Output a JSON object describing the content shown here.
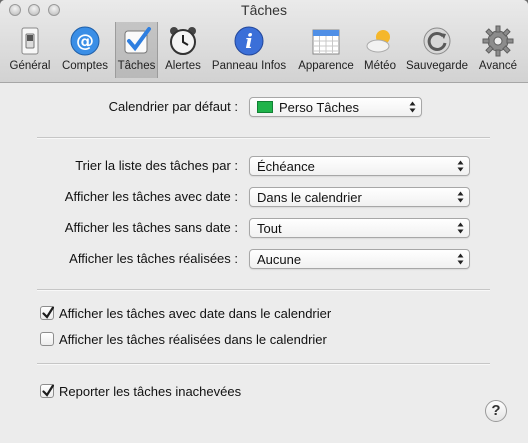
{
  "window": {
    "title": "Tâches"
  },
  "toolbar": {
    "items": [
      {
        "label": "Général",
        "icon": "light-switch-icon"
      },
      {
        "label": "Comptes",
        "icon": "at-sign-icon"
      },
      {
        "label": "Tâches",
        "icon": "checkbox-icon",
        "selected": true
      },
      {
        "label": "Alertes",
        "icon": "alarm-clock-icon"
      },
      {
        "label": "Panneau Infos",
        "icon": "info-icon"
      },
      {
        "label": "Apparence",
        "icon": "calendar-grid-icon"
      },
      {
        "label": "Météo",
        "icon": "weather-icon"
      },
      {
        "label": "Sauvegarde",
        "icon": "backup-icon"
      },
      {
        "label": "Avancé",
        "icon": "gear-icon"
      }
    ]
  },
  "default_calendar": {
    "label": "Calendrier par défaut :",
    "value": "Perso Tâches",
    "swatch_color": "#1fb34a"
  },
  "sort": {
    "label": "Trier la liste des tâches par :",
    "value": "Échéance"
  },
  "with_date": {
    "label": "Afficher les tâches avec date :",
    "value": "Dans le calendrier"
  },
  "without_date": {
    "label": "Afficher les tâches sans date :",
    "value": "Tout"
  },
  "completed": {
    "label": "Afficher les tâches réalisées :",
    "value": "Aucune"
  },
  "checks": {
    "show_dated_in_calendar": {
      "label": "Afficher les tâches avec date dans le calendrier",
      "checked": true
    },
    "show_completed_in_calendar": {
      "label": "Afficher les tâches réalisées dans le calendrier",
      "checked": false
    },
    "carry_over_unfinished": {
      "label": "Reporter les tâches inachevées",
      "checked": true
    }
  },
  "help": {
    "label": "?"
  }
}
